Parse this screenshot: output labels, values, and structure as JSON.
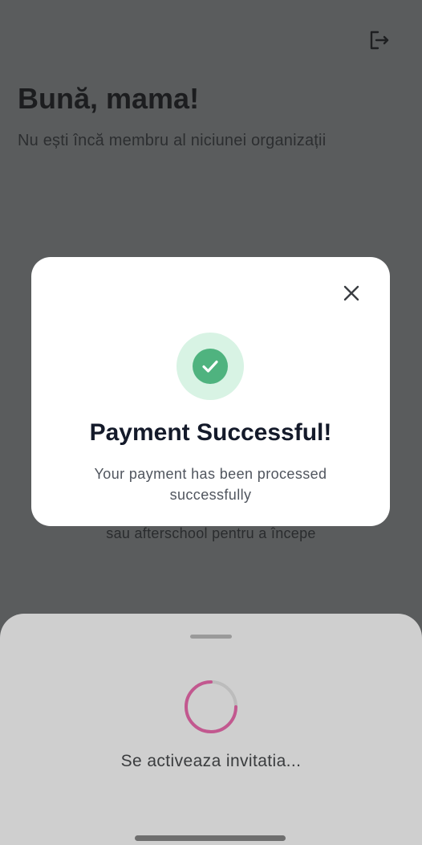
{
  "header": {
    "greeting": "Bună, mama!",
    "subtitle": "Nu ești încă membru al niciunei organizații",
    "logout_icon": "logout-icon"
  },
  "background": {
    "partial_text": "sau afterschool pentru a începe"
  },
  "modal": {
    "title": "Payment Successful!",
    "message": "Your payment has been processed successfully",
    "close_icon": "close-icon",
    "status_icon": "check-circle-icon",
    "accent_color": "#4fb37f"
  },
  "sheet": {
    "status_text": "Se activeaza invitatia...",
    "spinner_color": "#c2588f"
  }
}
